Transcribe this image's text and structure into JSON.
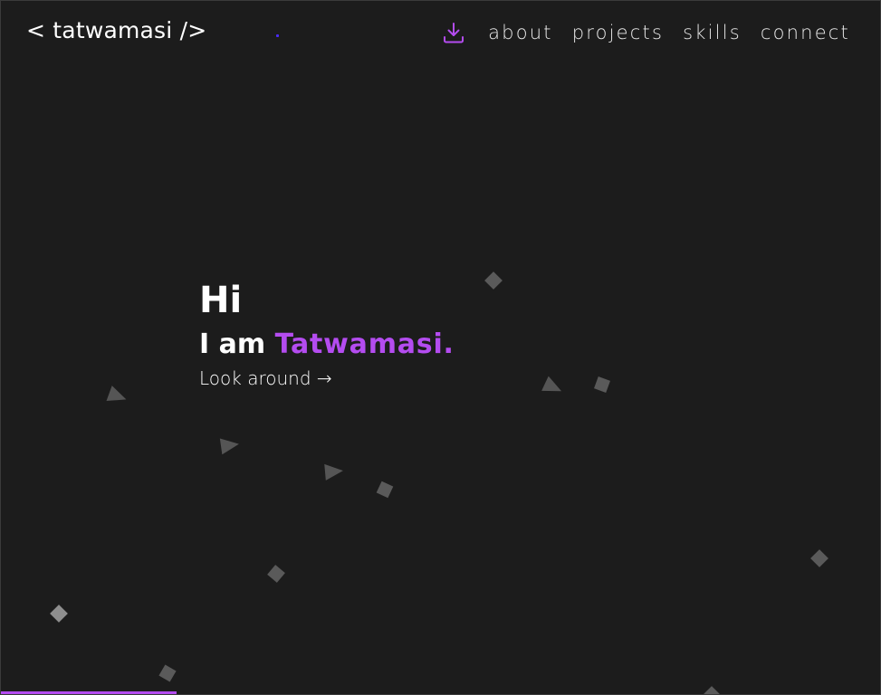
{
  "header": {
    "logo_text": "< tatwamasi />",
    "download_icon": "download-icon",
    "nav": [
      {
        "label": "about"
      },
      {
        "label": "projects"
      },
      {
        "label": "skills"
      },
      {
        "label": "connect"
      }
    ]
  },
  "hero": {
    "greeting": "Hi",
    "intro_prefix": "I am ",
    "name": "Tatwamasi.",
    "cta": "Look around →"
  },
  "scroll_progress_percent": 20,
  "colors": {
    "background": "#1c1c1c",
    "accent": "#b44cf0",
    "text": "#ffffff",
    "shape": "#5a5a5a"
  }
}
